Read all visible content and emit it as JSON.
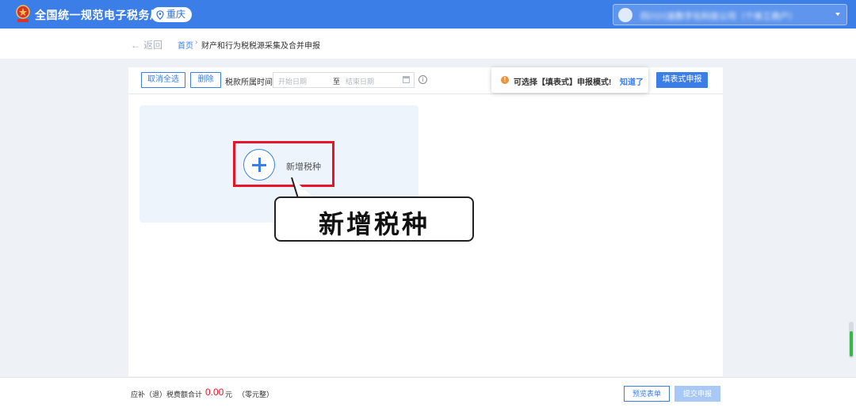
{
  "header": {
    "app_title": "全国统一规范电子税务局",
    "region": "重庆",
    "user_name": "四川川渝数字化科技公司（个体工商户）",
    "brand_color": "#3c7ee8"
  },
  "breadcrumb": {
    "back_label": "返回",
    "home": "首页",
    "separator": "›",
    "current": "财产和行为税税源采集及合并申报"
  },
  "toolbar": {
    "cancel_select_all": "取消全选",
    "delete": "删除",
    "period_label": "税款所属时间",
    "start_placeholder": "开始日期",
    "range_separator": "至",
    "end_placeholder": "结束日期",
    "info_icon": "i",
    "form_filing_button": "填表式申报"
  },
  "tooltip": {
    "icon": "!",
    "message": "可选择【填表式】申报模式!",
    "dismiss": "知道了"
  },
  "add_tax": {
    "label": "新增税种",
    "callout": "新增税种"
  },
  "footer": {
    "total_label": "应补（退）税费额合计",
    "total_amount": "0.00",
    "unit": "元",
    "amount_in_words": "（零元整）",
    "preview_button": "预览表单",
    "submit_button": "提交申报",
    "amount_color": "#e8142a"
  }
}
